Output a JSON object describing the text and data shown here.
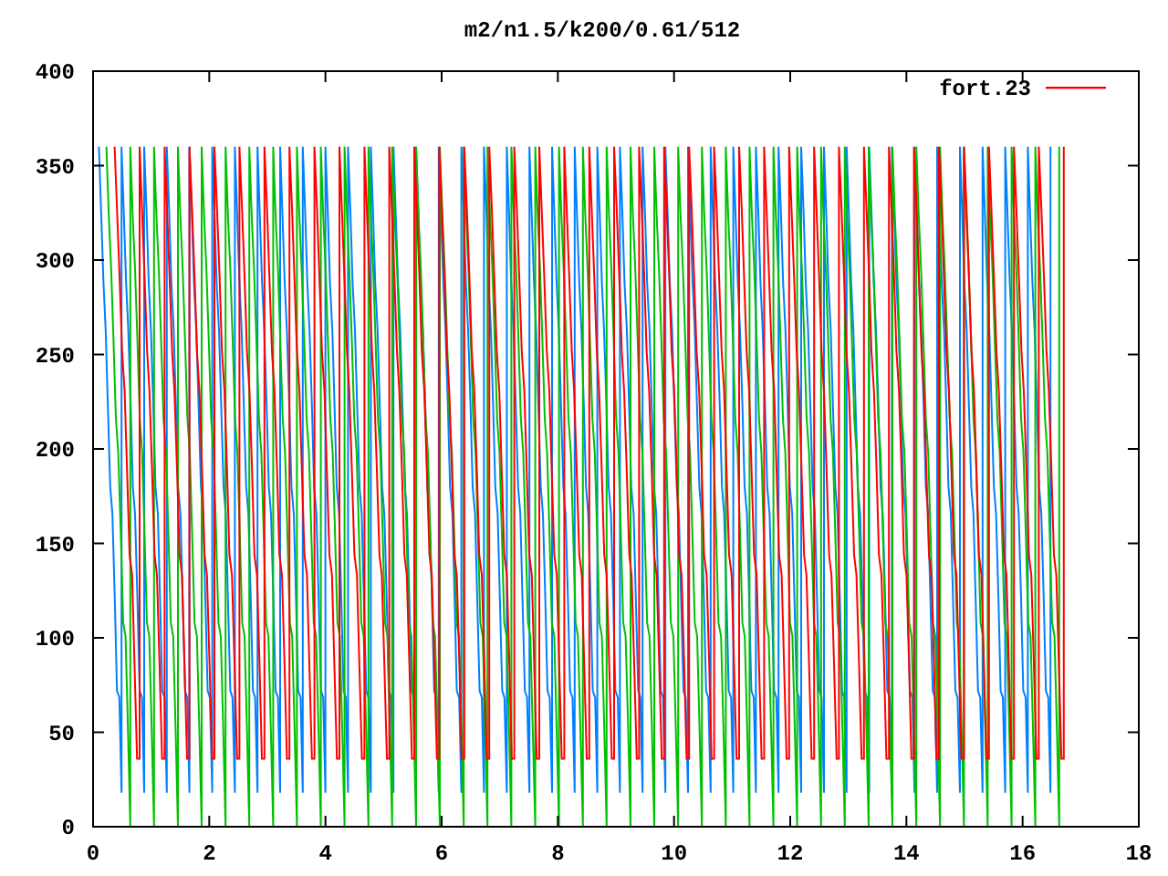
{
  "plot": {
    "chart_data": {
      "type": "line",
      "title": "m2/n1.5/k200/0.61/512",
      "xlim": [
        0,
        18
      ],
      "ylim": [
        0,
        400
      ],
      "xticks": [
        0,
        2,
        4,
        6,
        8,
        10,
        12,
        14,
        16,
        18
      ],
      "yticks": [
        0,
        50,
        100,
        150,
        200,
        250,
        300,
        350,
        400
      ]
    },
    "legend": {
      "label": "fort.23",
      "color": "#ff0000"
    }
  }
}
